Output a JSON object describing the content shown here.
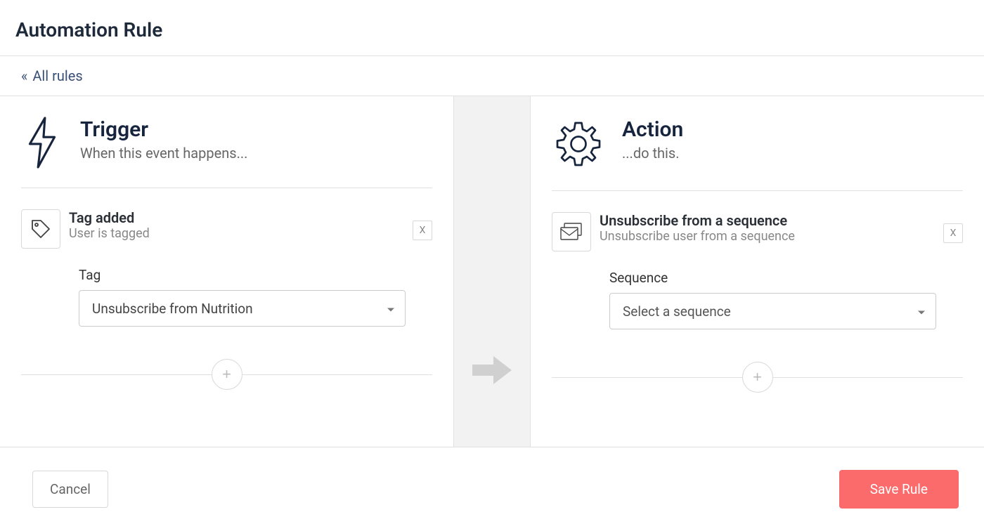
{
  "page": {
    "title": "Automation Rule"
  },
  "breadcrumb": {
    "back_label": "All rules",
    "back_prefix": "«"
  },
  "trigger": {
    "heading": "Trigger",
    "subheading": "When this event happens...",
    "card": {
      "title": "Tag added",
      "subtitle": "User is tagged",
      "remove": "X"
    },
    "field": {
      "label": "Tag",
      "value": "Unsubscribe from Nutrition"
    }
  },
  "action": {
    "heading": "Action",
    "subheading": "...do this.",
    "card": {
      "title": "Unsubscribe from a sequence",
      "subtitle": "Unsubscribe user from a sequence",
      "remove": "X"
    },
    "field": {
      "label": "Sequence",
      "placeholder": "Select a sequence"
    }
  },
  "divider": {
    "add_symbol": "+"
  },
  "footer": {
    "cancel": "Cancel",
    "save": "Save Rule"
  }
}
